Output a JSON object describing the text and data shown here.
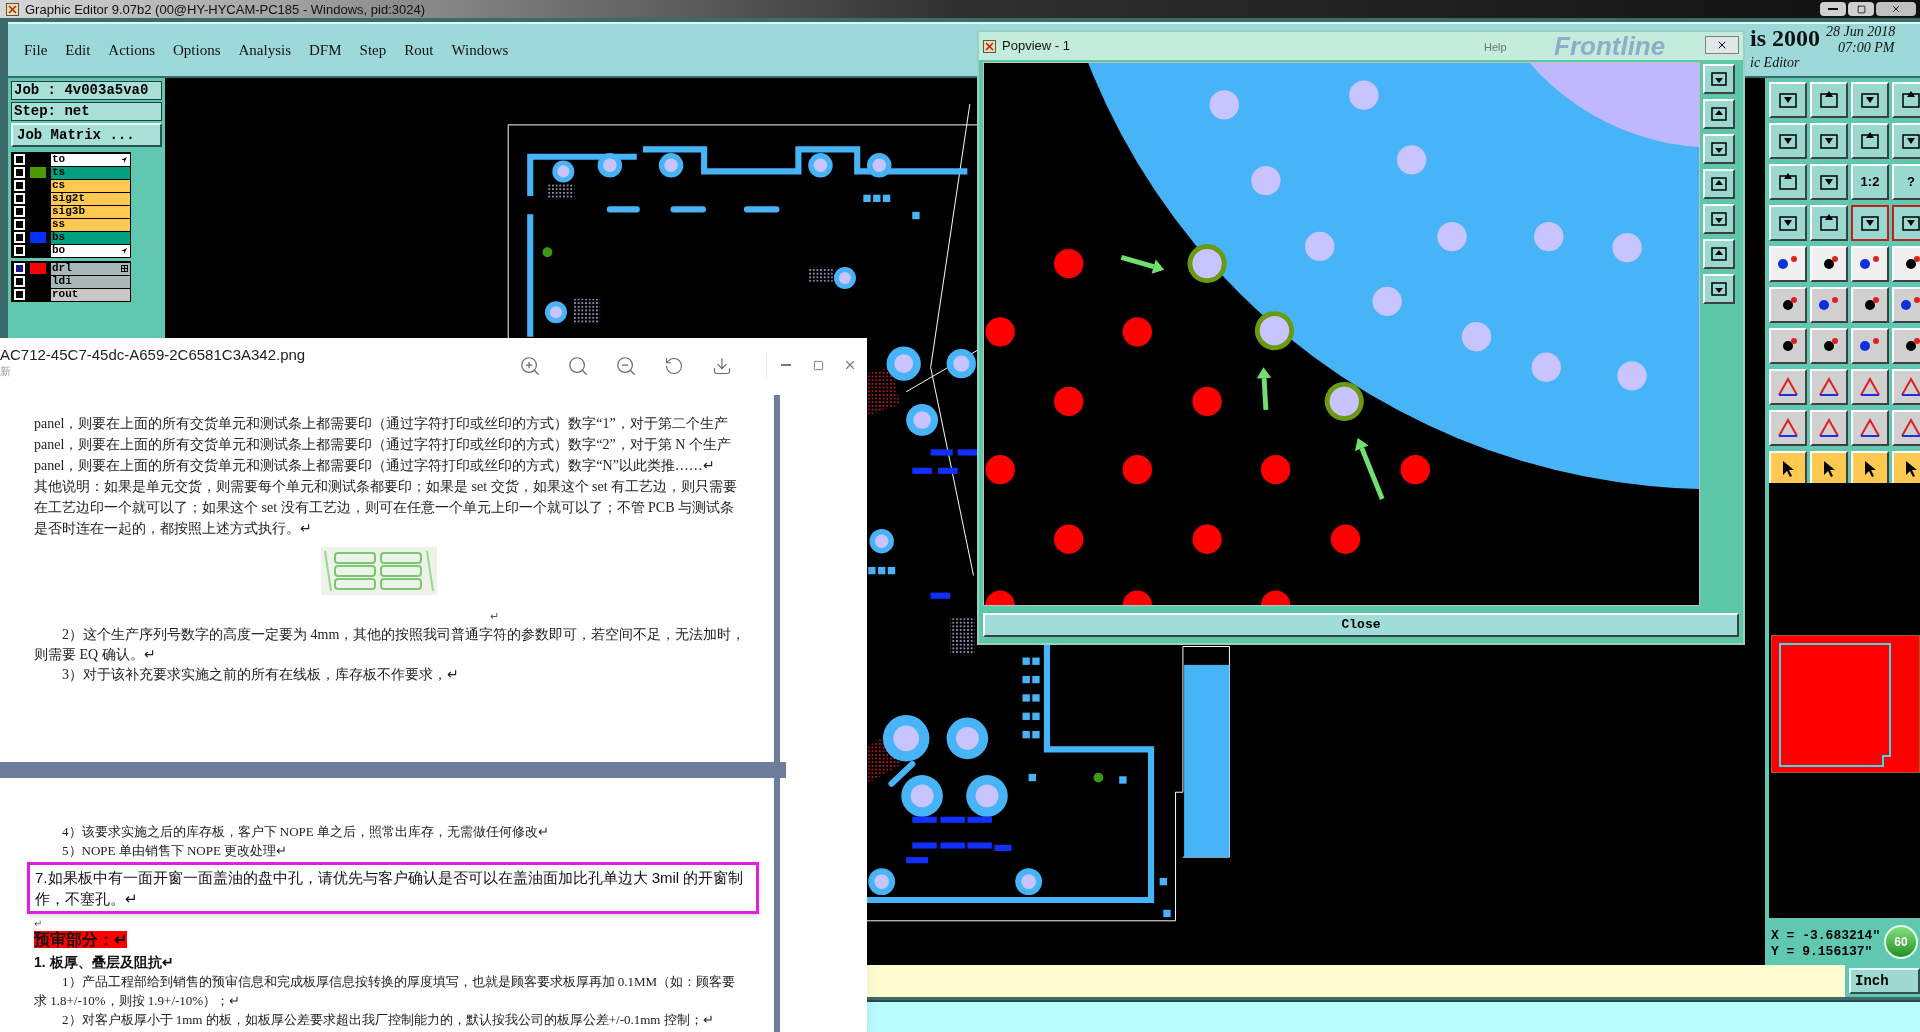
{
  "window": {
    "title": "Graphic Editor 9.07b2 (00@HY-HYCAM-PC185 - Windows, pid:3024)"
  },
  "menu": [
    "File",
    "Edit",
    "Actions",
    "Options",
    "Analysis",
    "DFM",
    "Step",
    "Rout",
    "Windows"
  ],
  "job": {
    "job": "Job : 4v003a5va0",
    "step": "Step: net",
    "matrix_button": "Job Matrix ..."
  },
  "layer_groups": [
    {
      "layers": [
        {
          "name": "to",
          "kind": "board",
          "selected": false,
          "pointer": true,
          "grid": false
        },
        {
          "name": "ts",
          "kind": "mask",
          "selected": false,
          "color": "#4a9a00",
          "pointer": false,
          "grid": false
        },
        {
          "name": "cs",
          "kind": "signal",
          "selected": false,
          "pointer": false,
          "grid": false
        },
        {
          "name": "sig2t",
          "kind": "signal",
          "selected": false,
          "pointer": false,
          "grid": false
        },
        {
          "name": "sig3b",
          "kind": "signal",
          "selected": false,
          "pointer": false,
          "grid": false
        },
        {
          "name": "ss",
          "kind": "signal",
          "selected": false,
          "pointer": false,
          "grid": false
        },
        {
          "name": "bs",
          "kind": "mask",
          "selected": false,
          "color": "#0030ff",
          "pointer": false,
          "grid": false
        },
        {
          "name": "bo",
          "kind": "board",
          "selected": false,
          "pointer": true,
          "grid": false
        }
      ]
    },
    {
      "layers": [
        {
          "name": "drl",
          "kind": "drill",
          "selected": true,
          "color": "#ff0000",
          "pointer": false,
          "grid": true
        },
        {
          "name": "ldi",
          "kind": "drill",
          "selected": false,
          "pointer": false,
          "grid": false
        },
        {
          "name": "rout",
          "kind": "rout",
          "selected": false,
          "pointer": false,
          "grid": false
        }
      ]
    }
  ],
  "brand": {
    "product": "is 2000",
    "date": "28 Jun 2018",
    "time": "07:00 PM",
    "subtitle": "ic Editor"
  },
  "toolbar": {
    "text_buttons": [
      "1:2",
      "?"
    ]
  },
  "coordinates": {
    "x": "X = -3.683214\"",
    "y": "Y = 9.156137\"",
    "badge": "60"
  },
  "status_bar": {
    "units_button": "Inch"
  },
  "viewer": {
    "file_name": "AC712-45C7-45dc-A659-2C6581C3A342.png",
    "subtitle": "新",
    "page_1": [
      {
        "kind": "text",
        "text": "panel，则要在上面的所有交货单元和测试条上都需要印（通过字符打印或丝印的方式）数字“1”，对于第二个生产panel，则要在上面的所有交货单元和测试条上都需要印（通过字符打印或丝印的方式）数字“2”，对于第 N 个生产 panel，则要在上面的所有交货单元和测试条上都需要印（通过字符打印或丝印的方式）数字“N”以此类推……↵"
      },
      {
        "kind": "text",
        "text": "其他说明：如果是单元交货，则需要每个单元和测试条都要印；如果是 set 交货，如果这个 set 有工艺边，则只需要在工艺边印一个就可以了；如果这个 set 没有工艺边，则可在任意一个单元上印一个就可以了；不管 PCB 与测试条是否时连在一起的，都按照上述方式执行。↵"
      },
      {
        "kind": "picture"
      },
      {
        "kind": "mark",
        "text": "↵"
      },
      {
        "kind": "indented",
        "text": "2）这个生产序列号数字的高度一定要为 4mm，其他的按照我司普通字符的参数即可，若空间不足，无法加时，则需要 EQ 确认。↵"
      },
      {
        "kind": "indented",
        "text": "3）对于该补充要求实施之前的所有在线板，库存板不作要求，↵"
      }
    ],
    "page_2": [
      {
        "kind": "indented",
        "text": "4）该要求实施之后的库存板，客户下 NOPE 单之后，照常出库存，无需做任何修改↵"
      },
      {
        "kind": "indented",
        "text": "5）NOPE 单由销售下 NOPE 更改处理↵"
      },
      {
        "kind": "boxed",
        "text": "7.如果板中有一面开窗一面盖油的盘中孔，请优先与客户确认是否可以在盖油面加比孔单边大 3mil 的开窗制作，不塞孔。↵"
      },
      {
        "kind": "mark",
        "text": "↵"
      },
      {
        "kind": "highlight",
        "text": "预审部分：↵"
      },
      {
        "kind": "heading",
        "text": "1. 板厚、叠层及阻抗↵"
      },
      {
        "kind": "indented",
        "text": "1）产品工程部给到销售的预审信息和完成板厚信息按转换的厚度填写，也就是顾客要求板厚再加 0.1MM（如：顾客要求 1.8+/-10%，则按 1.9+/-10%）；↵"
      },
      {
        "kind": "indented",
        "text": "2）对客户板厚小于 1mm 的板，如板厚公差要求超出我厂控制能力的，默认按我公司的板厚公差+/-0.1mm 控制；↵"
      }
    ]
  },
  "popview": {
    "title": "Popview - 1",
    "help": "Help",
    "logo": "Frontline",
    "close_button": "Close"
  }
}
